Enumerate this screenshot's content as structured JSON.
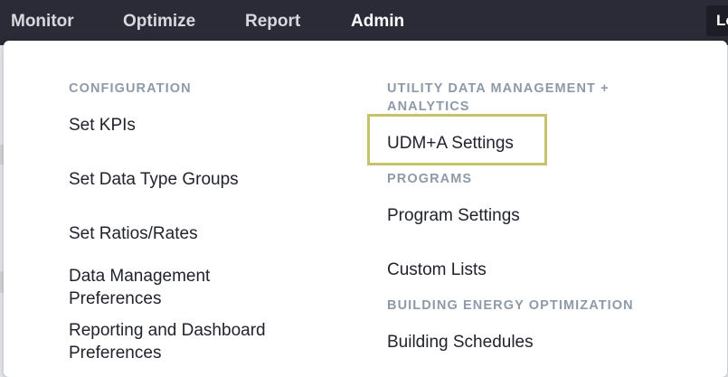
{
  "nav": {
    "items": [
      {
        "label": "Monitor",
        "active": false
      },
      {
        "label": "Optimize",
        "active": false
      },
      {
        "label": "Report",
        "active": false
      },
      {
        "label": "Admin",
        "active": true
      }
    ],
    "corner_button_label": "Lo"
  },
  "colors": {
    "topbar": "#2a2b37",
    "highlight_border": "#c7c36a",
    "section_heading": "#8e9aa8",
    "link_text": "#21232d"
  },
  "menu": {
    "configuration": {
      "heading": "CONFIGURATION",
      "links": [
        "Set KPIs",
        "Set Data Type Groups",
        "Set Ratios/Rates",
        "Data Management Preferences",
        "Reporting and Dashboard Preferences"
      ]
    },
    "udma": {
      "heading": "UTILITY DATA MANAGEMENT + ANALYTICS",
      "links": [
        "UDM+A Settings"
      ]
    },
    "programs": {
      "heading": "PROGRAMS",
      "links": [
        "Program Settings",
        "Custom Lists"
      ]
    },
    "beo": {
      "heading": "BUILDING ENERGY OPTIMIZATION",
      "links": [
        "Building Schedules"
      ]
    }
  }
}
